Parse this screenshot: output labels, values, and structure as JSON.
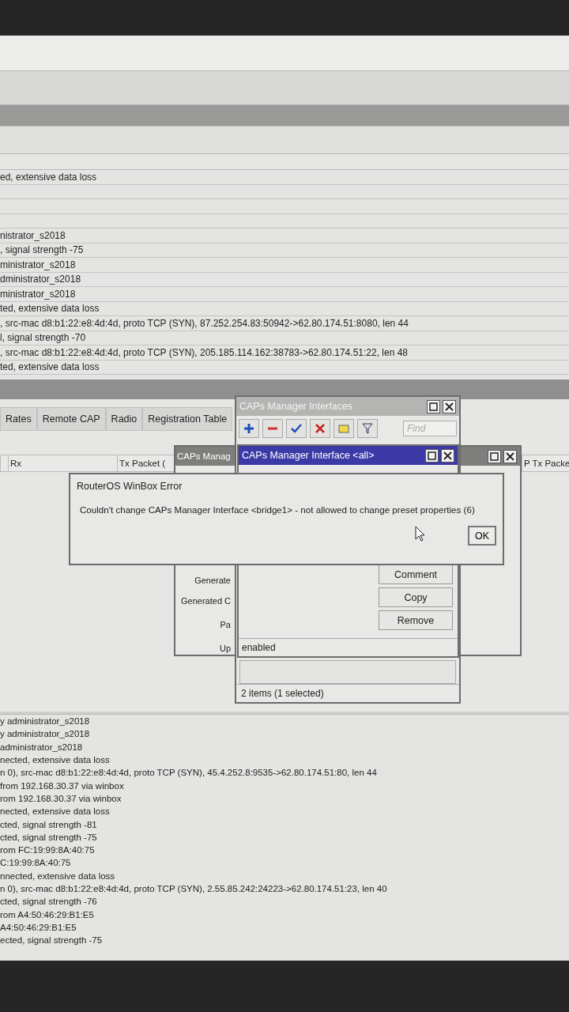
{
  "upper_log": {
    "rows": [
      {
        "kind": "text",
        "text": "ed, extensive data loss"
      },
      {
        "kind": "blank"
      },
      {
        "kind": "blank"
      },
      {
        "kind": "blank"
      },
      {
        "kind": "text",
        "text": "nistrator_s2018"
      },
      {
        "kind": "text",
        "text": ", signal strength -75"
      },
      {
        "kind": "text",
        "text": "ministrator_s2018"
      },
      {
        "kind": "text",
        "text": "dministrator_s2018"
      },
      {
        "kind": "text",
        "text": "ministrator_s2018"
      },
      {
        "kind": "text",
        "text": "ted, extensive data loss"
      },
      {
        "kind": "text",
        "text": ", src-mac d8:b1:22:e8:4d:4d, proto TCP (SYN), 87.252.254.83:50942->62.80.174.51:8080, len 44"
      },
      {
        "kind": "text",
        "text": "l, signal strength -70"
      },
      {
        "kind": "text",
        "text": ", src-mac d8:b1:22:e8:4d:4d, proto TCP (SYN), 205.185.114.162:38783->62.80.174.51:22, len 48"
      },
      {
        "kind": "text",
        "text": "ted, extensive data loss"
      }
    ]
  },
  "tabs": [
    {
      "label": "Rates"
    },
    {
      "label": "Remote CAP"
    },
    {
      "label": "Radio"
    },
    {
      "label": "Registration Table"
    }
  ],
  "columns": [
    "Rx",
    "Tx Packet (",
    "P Tx Packe"
  ],
  "back_window": {
    "title": "CAPs Manag",
    "labels": [
      "Generate",
      "Generated C",
      "Pa",
      "Up"
    ]
  },
  "interfaces_window": {
    "title": "CAPs Manager Interfaces",
    "find_placeholder": "Find",
    "status": "2 items (1 selected)"
  },
  "interface_dialog": {
    "title": "CAPs Manager Interface <all>",
    "buttons": [
      "Comment",
      "Copy",
      "Remove"
    ],
    "status": "enabled"
  },
  "error_dialog": {
    "title": "RouterOS WinBox Error",
    "message": "Couldn't change CAPs Manager Interface <bridge1> - not allowed to change preset properties (6)",
    "button": "OK"
  },
  "lower_log": {
    "rows": [
      "y administrator_s2018",
      "y administrator_s2018",
      "administrator_s2018",
      "nected, extensive data loss",
      "n 0), src-mac d8:b1:22:e8:4d:4d, proto TCP (SYN), 45.4.252.8:9535->62.80.174.51:80, len 44",
      "from 192.168.30.37 via winbox",
      "rom 192.168.30.37 via winbox",
      "nected, extensive data loss",
      "cted, signal strength -81",
      "cted, signal strength -75",
      "rom FC:19:99:8A:40:75",
      "C:19:99:8A:40:75",
      "nnected, extensive data loss",
      "n 0), src-mac d8:b1:22:e8:4d:4d, proto TCP (SYN), 2.55.85.242:24223->62.80.174.51:23, len 40",
      "cted, signal strength -76",
      "rom A4:50:46:29:B1:E5",
      "A4:50:46:29:B1:E5",
      "ected, signal strength -75"
    ]
  }
}
